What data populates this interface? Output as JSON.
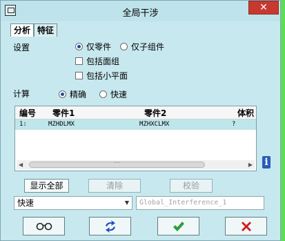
{
  "window": {
    "title": "全局干涉",
    "close_label": "✕"
  },
  "tabs": [
    {
      "label": "分析",
      "active": true
    },
    {
      "label": "特征",
      "active": false
    }
  ],
  "settings": {
    "label": "设置",
    "radio_parts_only": "仅零件",
    "radio_subassemblies_only": "仅子组件",
    "check_include_quilts": "包括面组",
    "check_include_facets": "包括小平面"
  },
  "compute": {
    "label": "计算",
    "radio_exact": "精确",
    "radio_quick": "快速"
  },
  "table": {
    "columns": [
      "编号",
      "零件1",
      "零件2",
      "体积"
    ],
    "rows": [
      [
        "1:",
        "MZHDLMX",
        "MZHXCLMX",
        "?"
      ]
    ],
    "scroll_left": "◀",
    "scroll_right": "▶",
    "scroll_grip": "⋯"
  },
  "buttons": {
    "show_all": "显示全部",
    "clear": "清除",
    "verify": "校验"
  },
  "mode_select": {
    "value": "快速"
  },
  "name_input": {
    "placeholder": "Global_Interference_1"
  },
  "info_glyph": "i",
  "colors": {
    "window_bg": "#c7e8ee",
    "close": "#c7392f",
    "ok_green": "#2e9d3a",
    "cancel_red": "#d11b1b",
    "desktop": "#5fdc5a"
  }
}
